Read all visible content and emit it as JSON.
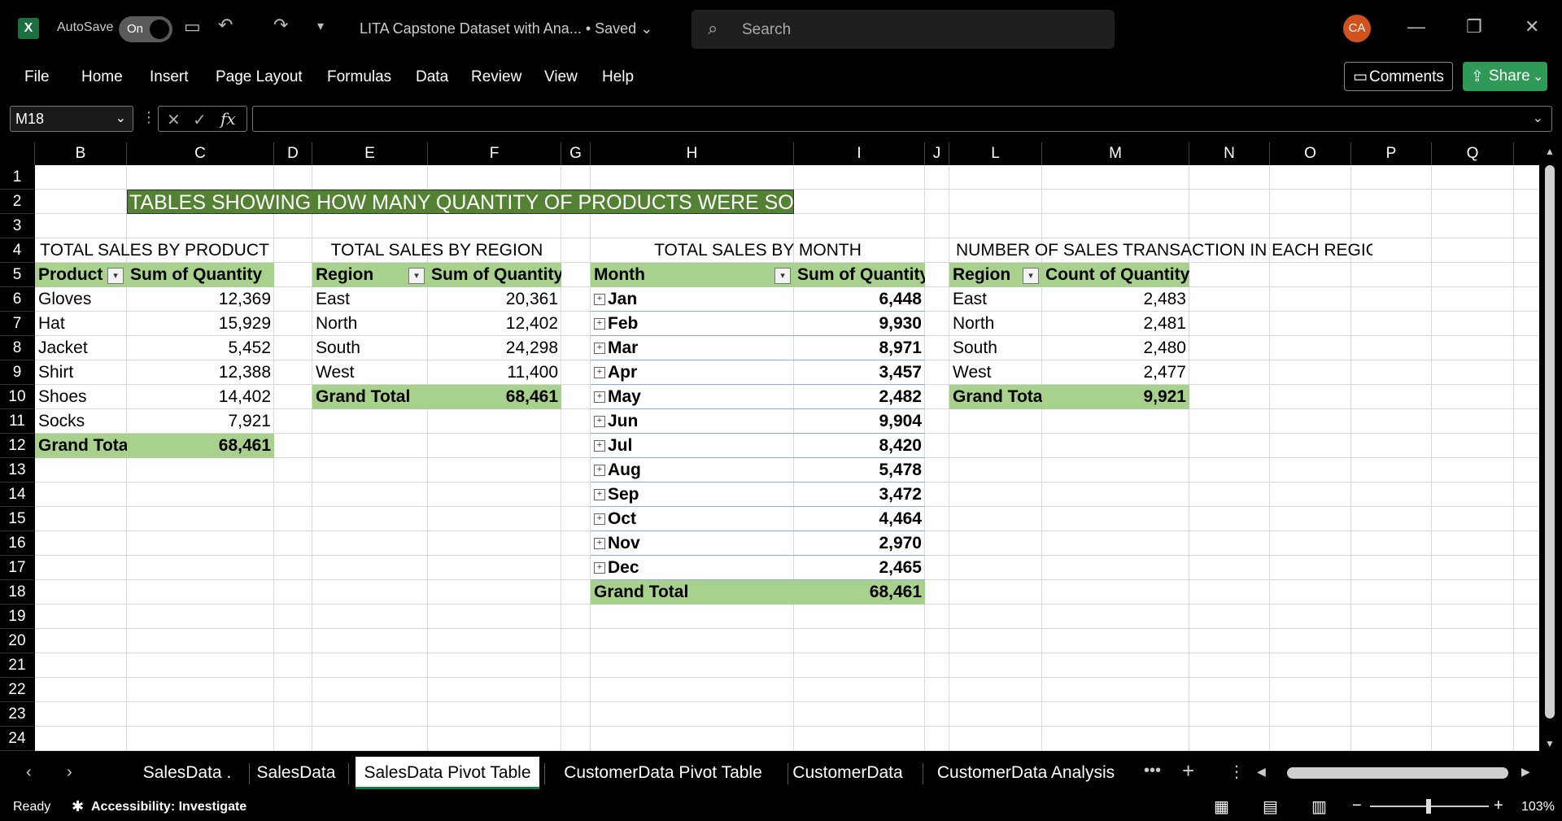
{
  "titlebar": {
    "autosave_label": "AutoSave",
    "toggle_state": "On",
    "doc_title": "LITA Capstone Dataset with Ana...",
    "saved_status": "• Saved",
    "search_placeholder": "Search",
    "avatar_initials": "CA"
  },
  "menu": [
    "File",
    "Home",
    "Insert",
    "Page Layout",
    "Formulas",
    "Data",
    "Review",
    "View",
    "Help"
  ],
  "actions": {
    "comments": "Comments",
    "share": "Share"
  },
  "formula_bar": {
    "name_box": "M18",
    "fx": "fx",
    "content": ""
  },
  "columns": [
    "B",
    "C",
    "D",
    "E",
    "F",
    "G",
    "H",
    "I",
    "J",
    "L",
    "M",
    "N",
    "O",
    "P",
    "Q"
  ],
  "rows": [
    "1",
    "2",
    "3",
    "4",
    "5",
    "6",
    "7",
    "8",
    "9",
    "10",
    "11",
    "12",
    "13",
    "14",
    "15",
    "16",
    "17",
    "18",
    "19",
    "20",
    "21",
    "22",
    "23",
    "24"
  ],
  "banner": "TABLES SHOWING HOW MANY QUANTITY OF PRODUCTS WERE SOLD",
  "pivot_product": {
    "title": "TOTAL SALES BY PRODUCT",
    "headers": [
      "Product",
      "Sum of Quantity"
    ],
    "rows": [
      [
        "Gloves",
        "12,369"
      ],
      [
        "Hat",
        "15,929"
      ],
      [
        "Jacket",
        "5,452"
      ],
      [
        "Shirt",
        "12,388"
      ],
      [
        "Shoes",
        "14,402"
      ],
      [
        "Socks",
        "7,921"
      ]
    ],
    "total": [
      "Grand Total",
      "68,461"
    ]
  },
  "pivot_region": {
    "title": "TOTAL SALES BY REGION",
    "headers": [
      "Region",
      "Sum of Quantity"
    ],
    "rows": [
      [
        "East",
        "20,361"
      ],
      [
        "North",
        "12,402"
      ],
      [
        "South",
        "24,298"
      ],
      [
        "West",
        "11,400"
      ]
    ],
    "total": [
      "Grand Total",
      "68,461"
    ]
  },
  "pivot_month": {
    "title": "TOTAL SALES BY MONTH",
    "headers": [
      "Month",
      "Sum of Quantity"
    ],
    "rows": [
      [
        "Jan",
        "6,448"
      ],
      [
        "Feb",
        "9,930"
      ],
      [
        "Mar",
        "8,971"
      ],
      [
        "Apr",
        "3,457"
      ],
      [
        "May",
        "2,482"
      ],
      [
        "Jun",
        "9,904"
      ],
      [
        "Jul",
        "8,420"
      ],
      [
        "Aug",
        "5,478"
      ],
      [
        "Sep",
        "3,472"
      ],
      [
        "Oct",
        "4,464"
      ],
      [
        "Nov",
        "2,970"
      ],
      [
        "Dec",
        "2,465"
      ]
    ],
    "total": [
      "Grand Total",
      "68,461"
    ]
  },
  "pivot_count": {
    "title": "NUMBER OF SALES TRANSACTION IN EACH REGION",
    "headers": [
      "Region",
      "Count of Quantity"
    ],
    "rows": [
      [
        "East",
        "2,483"
      ],
      [
        "North",
        "2,481"
      ],
      [
        "South",
        "2,480"
      ],
      [
        "West",
        "2,477"
      ]
    ],
    "total": [
      "Grand Total",
      "9,921"
    ]
  },
  "tabs": [
    "SalesData .",
    "SalesData",
    "SalesData Pivot Table",
    "CustomerData Pivot Table",
    "CustomerData",
    "CustomerData Analysis"
  ],
  "active_tab": "SalesData Pivot Table",
  "status": {
    "ready": "Ready",
    "accessibility": "Accessibility: Investigate",
    "zoom": "103%"
  },
  "colors": {
    "excel_green": "#1d6f42",
    "pivot_green": "#a9d18e",
    "banner_green": "#548235",
    "share_green": "#2f9a57"
  }
}
